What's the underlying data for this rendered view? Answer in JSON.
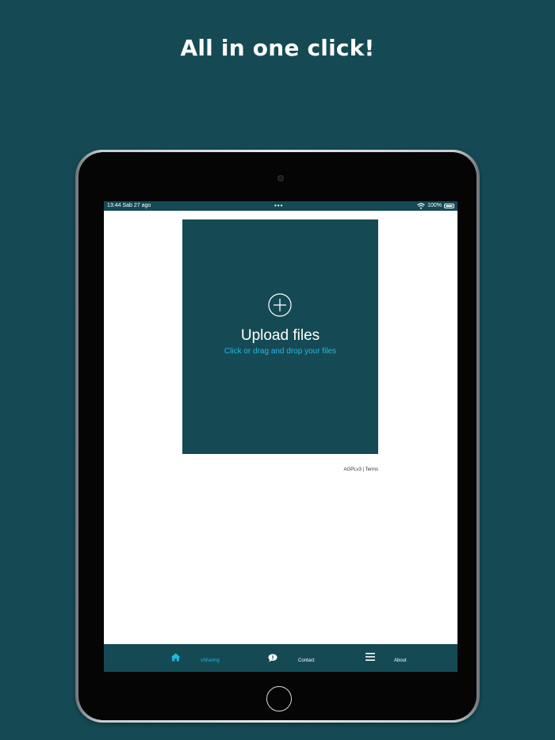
{
  "headline": "All in one click!",
  "status_bar": {
    "time_date": "13:44  Sab 27 ago",
    "dots": "•••",
    "battery": "100%"
  },
  "upload": {
    "title": "Upload files",
    "subtitle": "Click or drag and drop your files"
  },
  "footer": {
    "links": "AGPLv3 | Terms"
  },
  "tabs": [
    {
      "label": "vSharing",
      "icon": "home-icon",
      "active": true
    },
    {
      "label": "Contact",
      "icon": "chat-icon",
      "active": false
    },
    {
      "label": "About",
      "icon": "menu-icon",
      "active": false
    }
  ],
  "colors": {
    "background": "#154a54",
    "accent": "#22b8e0",
    "screen": "#ffffff"
  }
}
